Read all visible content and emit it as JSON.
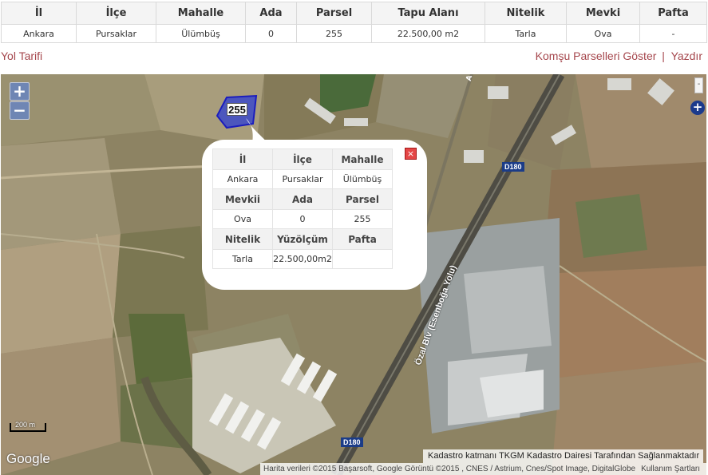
{
  "parcel_table": {
    "headers": [
      "İl",
      "İlçe",
      "Mahalle",
      "Ada",
      "Parsel",
      "Tapu Alanı",
      "Nitelik",
      "Mevki",
      "Pafta"
    ],
    "values": [
      "Ankara",
      "Pursaklar",
      "Ülümbüş",
      "0",
      "255",
      "22.500,00 m2",
      "Tarla",
      "Ova",
      "-"
    ]
  },
  "links": {
    "yol_tarifi": "Yol Tarifi",
    "komsu": "Komşu Parselleri Göster",
    "separator": "|",
    "yazdir": "Yazdır"
  },
  "map": {
    "zoom_in": "+",
    "zoom_out": "−",
    "layer_minus": "-",
    "layer_plus": "+",
    "parcel_label": "255",
    "road_labels": [
      "D180",
      "D180"
    ],
    "street_label": "Özal Blv (Esenboğa Yolu)",
    "road_a": "A",
    "scale_label": "200 m",
    "google": "Google",
    "kadastro_notice": "Kadastro katmanı TKGM Kadastro Dairesi Tarafından Sağlanmaktadır",
    "attribution": "Harita verileri ©2015 Başarsoft, Google Görüntü ©2015 , CNES / Astrium, Cnes/Spot Image, DigitalGlobe",
    "terms": "Kullanım Şartları"
  },
  "popup": {
    "close_icon": "×",
    "rows": [
      {
        "headers": [
          "İl",
          "İlçe",
          "Mahalle"
        ],
        "values": [
          "Ankara",
          "Pursaklar",
          "Ülümbüş"
        ]
      },
      {
        "headers": [
          "Mevkii",
          "Ada",
          "Parsel"
        ],
        "values": [
          "Ova",
          "0",
          "255"
        ]
      },
      {
        "headers": [
          "Nitelik",
          "Yüzölçüm",
          "Pafta"
        ],
        "values": [
          "Tarla",
          "22.500,00m2",
          ""
        ]
      }
    ]
  },
  "colors": {
    "link": "#a5464c",
    "parcel_fill": "#2d3fd3",
    "road_badge": "#1b3c88"
  }
}
